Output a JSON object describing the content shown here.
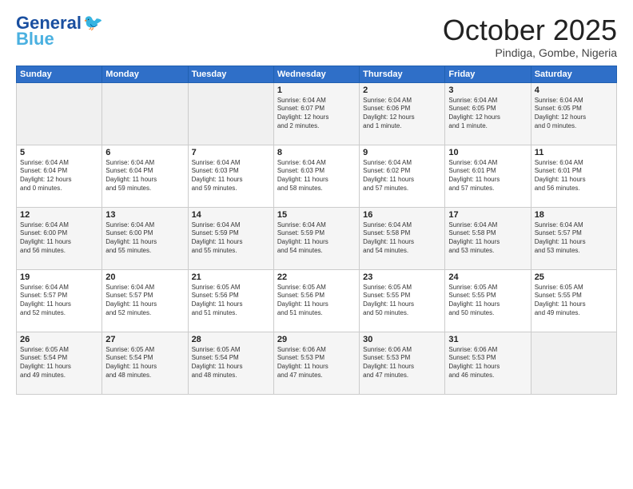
{
  "header": {
    "logo_main": "General",
    "logo_accent": "Blue",
    "month": "October 2025",
    "location": "Pindiga, Gombe, Nigeria"
  },
  "weekdays": [
    "Sunday",
    "Monday",
    "Tuesday",
    "Wednesday",
    "Thursday",
    "Friday",
    "Saturday"
  ],
  "weeks": [
    [
      {
        "day": "",
        "info": ""
      },
      {
        "day": "",
        "info": ""
      },
      {
        "day": "",
        "info": ""
      },
      {
        "day": "1",
        "info": "Sunrise: 6:04 AM\nSunset: 6:07 PM\nDaylight: 12 hours\nand 2 minutes."
      },
      {
        "day": "2",
        "info": "Sunrise: 6:04 AM\nSunset: 6:06 PM\nDaylight: 12 hours\nand 1 minute."
      },
      {
        "day": "3",
        "info": "Sunrise: 6:04 AM\nSunset: 6:05 PM\nDaylight: 12 hours\nand 1 minute."
      },
      {
        "day": "4",
        "info": "Sunrise: 6:04 AM\nSunset: 6:05 PM\nDaylight: 12 hours\nand 0 minutes."
      }
    ],
    [
      {
        "day": "5",
        "info": "Sunrise: 6:04 AM\nSunset: 6:04 PM\nDaylight: 12 hours\nand 0 minutes."
      },
      {
        "day": "6",
        "info": "Sunrise: 6:04 AM\nSunset: 6:04 PM\nDaylight: 11 hours\nand 59 minutes."
      },
      {
        "day": "7",
        "info": "Sunrise: 6:04 AM\nSunset: 6:03 PM\nDaylight: 11 hours\nand 59 minutes."
      },
      {
        "day": "8",
        "info": "Sunrise: 6:04 AM\nSunset: 6:03 PM\nDaylight: 11 hours\nand 58 minutes."
      },
      {
        "day": "9",
        "info": "Sunrise: 6:04 AM\nSunset: 6:02 PM\nDaylight: 11 hours\nand 57 minutes."
      },
      {
        "day": "10",
        "info": "Sunrise: 6:04 AM\nSunset: 6:01 PM\nDaylight: 11 hours\nand 57 minutes."
      },
      {
        "day": "11",
        "info": "Sunrise: 6:04 AM\nSunset: 6:01 PM\nDaylight: 11 hours\nand 56 minutes."
      }
    ],
    [
      {
        "day": "12",
        "info": "Sunrise: 6:04 AM\nSunset: 6:00 PM\nDaylight: 11 hours\nand 56 minutes."
      },
      {
        "day": "13",
        "info": "Sunrise: 6:04 AM\nSunset: 6:00 PM\nDaylight: 11 hours\nand 55 minutes."
      },
      {
        "day": "14",
        "info": "Sunrise: 6:04 AM\nSunset: 5:59 PM\nDaylight: 11 hours\nand 55 minutes."
      },
      {
        "day": "15",
        "info": "Sunrise: 6:04 AM\nSunset: 5:59 PM\nDaylight: 11 hours\nand 54 minutes."
      },
      {
        "day": "16",
        "info": "Sunrise: 6:04 AM\nSunset: 5:58 PM\nDaylight: 11 hours\nand 54 minutes."
      },
      {
        "day": "17",
        "info": "Sunrise: 6:04 AM\nSunset: 5:58 PM\nDaylight: 11 hours\nand 53 minutes."
      },
      {
        "day": "18",
        "info": "Sunrise: 6:04 AM\nSunset: 5:57 PM\nDaylight: 11 hours\nand 53 minutes."
      }
    ],
    [
      {
        "day": "19",
        "info": "Sunrise: 6:04 AM\nSunset: 5:57 PM\nDaylight: 11 hours\nand 52 minutes."
      },
      {
        "day": "20",
        "info": "Sunrise: 6:04 AM\nSunset: 5:57 PM\nDaylight: 11 hours\nand 52 minutes."
      },
      {
        "day": "21",
        "info": "Sunrise: 6:05 AM\nSunset: 5:56 PM\nDaylight: 11 hours\nand 51 minutes."
      },
      {
        "day": "22",
        "info": "Sunrise: 6:05 AM\nSunset: 5:56 PM\nDaylight: 11 hours\nand 51 minutes."
      },
      {
        "day": "23",
        "info": "Sunrise: 6:05 AM\nSunset: 5:55 PM\nDaylight: 11 hours\nand 50 minutes."
      },
      {
        "day": "24",
        "info": "Sunrise: 6:05 AM\nSunset: 5:55 PM\nDaylight: 11 hours\nand 50 minutes."
      },
      {
        "day": "25",
        "info": "Sunrise: 6:05 AM\nSunset: 5:55 PM\nDaylight: 11 hours\nand 49 minutes."
      }
    ],
    [
      {
        "day": "26",
        "info": "Sunrise: 6:05 AM\nSunset: 5:54 PM\nDaylight: 11 hours\nand 49 minutes."
      },
      {
        "day": "27",
        "info": "Sunrise: 6:05 AM\nSunset: 5:54 PM\nDaylight: 11 hours\nand 48 minutes."
      },
      {
        "day": "28",
        "info": "Sunrise: 6:05 AM\nSunset: 5:54 PM\nDaylight: 11 hours\nand 48 minutes."
      },
      {
        "day": "29",
        "info": "Sunrise: 6:06 AM\nSunset: 5:53 PM\nDaylight: 11 hours\nand 47 minutes."
      },
      {
        "day": "30",
        "info": "Sunrise: 6:06 AM\nSunset: 5:53 PM\nDaylight: 11 hours\nand 47 minutes."
      },
      {
        "day": "31",
        "info": "Sunrise: 6:06 AM\nSunset: 5:53 PM\nDaylight: 11 hours\nand 46 minutes."
      },
      {
        "day": "",
        "info": ""
      }
    ]
  ]
}
